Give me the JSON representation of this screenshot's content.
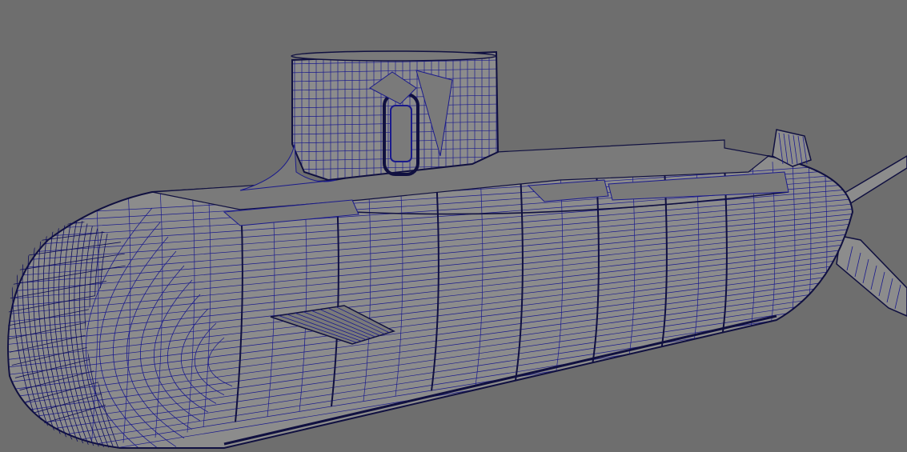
{
  "viewport": {
    "background_color": "#6e6e6e",
    "shade_color": "#8c8c8c",
    "shade_dark_color": "#7a7a7a",
    "wire_color": "#1a1a8c",
    "wire_dark_color": "#0d0d5a",
    "silhouette_color": "#101040"
  },
  "model": {
    "parts": [
      "hull",
      "sail",
      "deck",
      "bow-dome",
      "hydroplane",
      "rudder-top",
      "propeller-shaft",
      "stern-fin"
    ]
  }
}
